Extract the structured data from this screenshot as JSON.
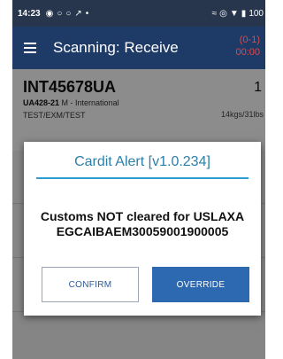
{
  "status_bar": {
    "time": "14:23",
    "left_icons": [
      "notification-icon",
      "notification-icon",
      "notification-icon",
      "notification-icon"
    ],
    "left_glyphs": [
      "◉",
      "○",
      "○",
      "↗"
    ],
    "dot": "•",
    "right_text": "100"
  },
  "app_bar": {
    "title": "Scanning: Receive",
    "badge_line1": "(0-1)",
    "badge_line2": "00:00"
  },
  "card": {
    "id": "INT45678UA",
    "count": "1",
    "flight": "UA428-21",
    "flight_suffix": "M - International",
    "route": "TEST/EXM/TEST",
    "weight": "14kgs/31lbs"
  },
  "dialog": {
    "title": "Cardit Alert [v1.0.234]",
    "message_line1": "Customs NOT cleared for USLAXA",
    "message_line2": "EGCAIBAEM30059001900005",
    "confirm_label": "CONFIRM",
    "override_label": "OVERRIDE"
  },
  "colors": {
    "app_bar": "#1e3a66",
    "status_bar": "#27354d",
    "dialog_title": "#2c7fa8",
    "dialog_rule": "#2c9fd0",
    "override_button": "#2c69b0",
    "badge": "#e04848"
  }
}
